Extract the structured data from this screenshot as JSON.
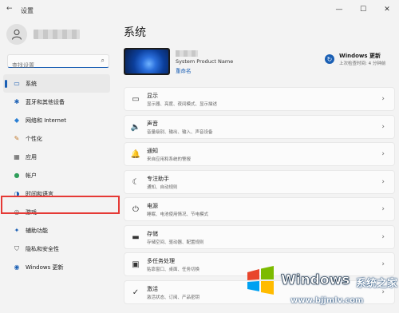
{
  "window": {
    "title": "设置",
    "back_icon": "←",
    "minimize_icon": "—",
    "maximize_icon": "☐",
    "close_icon": "✕"
  },
  "search": {
    "placeholder": "查找设置",
    "icon": "search-icon"
  },
  "sidebar": {
    "items": [
      {
        "label": "系统",
        "icon": "▭",
        "selected": true
      },
      {
        "label": "蓝牙和其他设备",
        "icon": "✱"
      },
      {
        "label": "网络和 Internet",
        "icon": "◆"
      },
      {
        "label": "个性化",
        "icon": "✎"
      },
      {
        "label": "应用",
        "icon": "▦"
      },
      {
        "label": "帐户",
        "icon": "●"
      },
      {
        "label": "时间和语言",
        "icon": "◑"
      },
      {
        "label": "游戏",
        "icon": "◎"
      },
      {
        "label": "辅助功能",
        "icon": "✦"
      },
      {
        "label": "隐私和安全性",
        "icon": "⛉"
      },
      {
        "label": "Windows 更新",
        "icon": "◉"
      }
    ]
  },
  "main": {
    "title": "系统",
    "device": {
      "model": "System Product Name",
      "rename": "重命名"
    },
    "update": {
      "icon": "↻",
      "title": "Windows 更新",
      "subtitle": "上次检查时间: 4 分钟前"
    },
    "cards": [
      {
        "title": "显示",
        "desc": "显示器、亮度、夜间模式、显示描述",
        "icon": "▭"
      },
      {
        "title": "声音",
        "desc": "音量级别、输出、输入、声音设备",
        "icon": "🔈"
      },
      {
        "title": "通知",
        "desc": "来自应用和系统的警报",
        "icon": "🔔"
      },
      {
        "title": "专注助手",
        "desc": "通知、自动规则",
        "icon": "☾"
      },
      {
        "title": "电源",
        "desc": "睡眠、电池使用情况、节电模式",
        "icon": "⏻"
      },
      {
        "title": "存储",
        "desc": "存储空间、驱动器、配置规则",
        "icon": "▬"
      },
      {
        "title": "多任务处理",
        "desc": "贴靠窗口、桌面、任务切换",
        "icon": "▣"
      },
      {
        "title": "激活",
        "desc": "激活状态、订阅、产品密钥",
        "icon": "✓"
      }
    ],
    "chevron": "›"
  },
  "watermark": {
    "brand": "Windows",
    "cn": "系统之家",
    "url": "www.bjjmlv.com"
  },
  "colors": {
    "accent": "#1a5fb4",
    "highlight_box": "#e53935"
  }
}
